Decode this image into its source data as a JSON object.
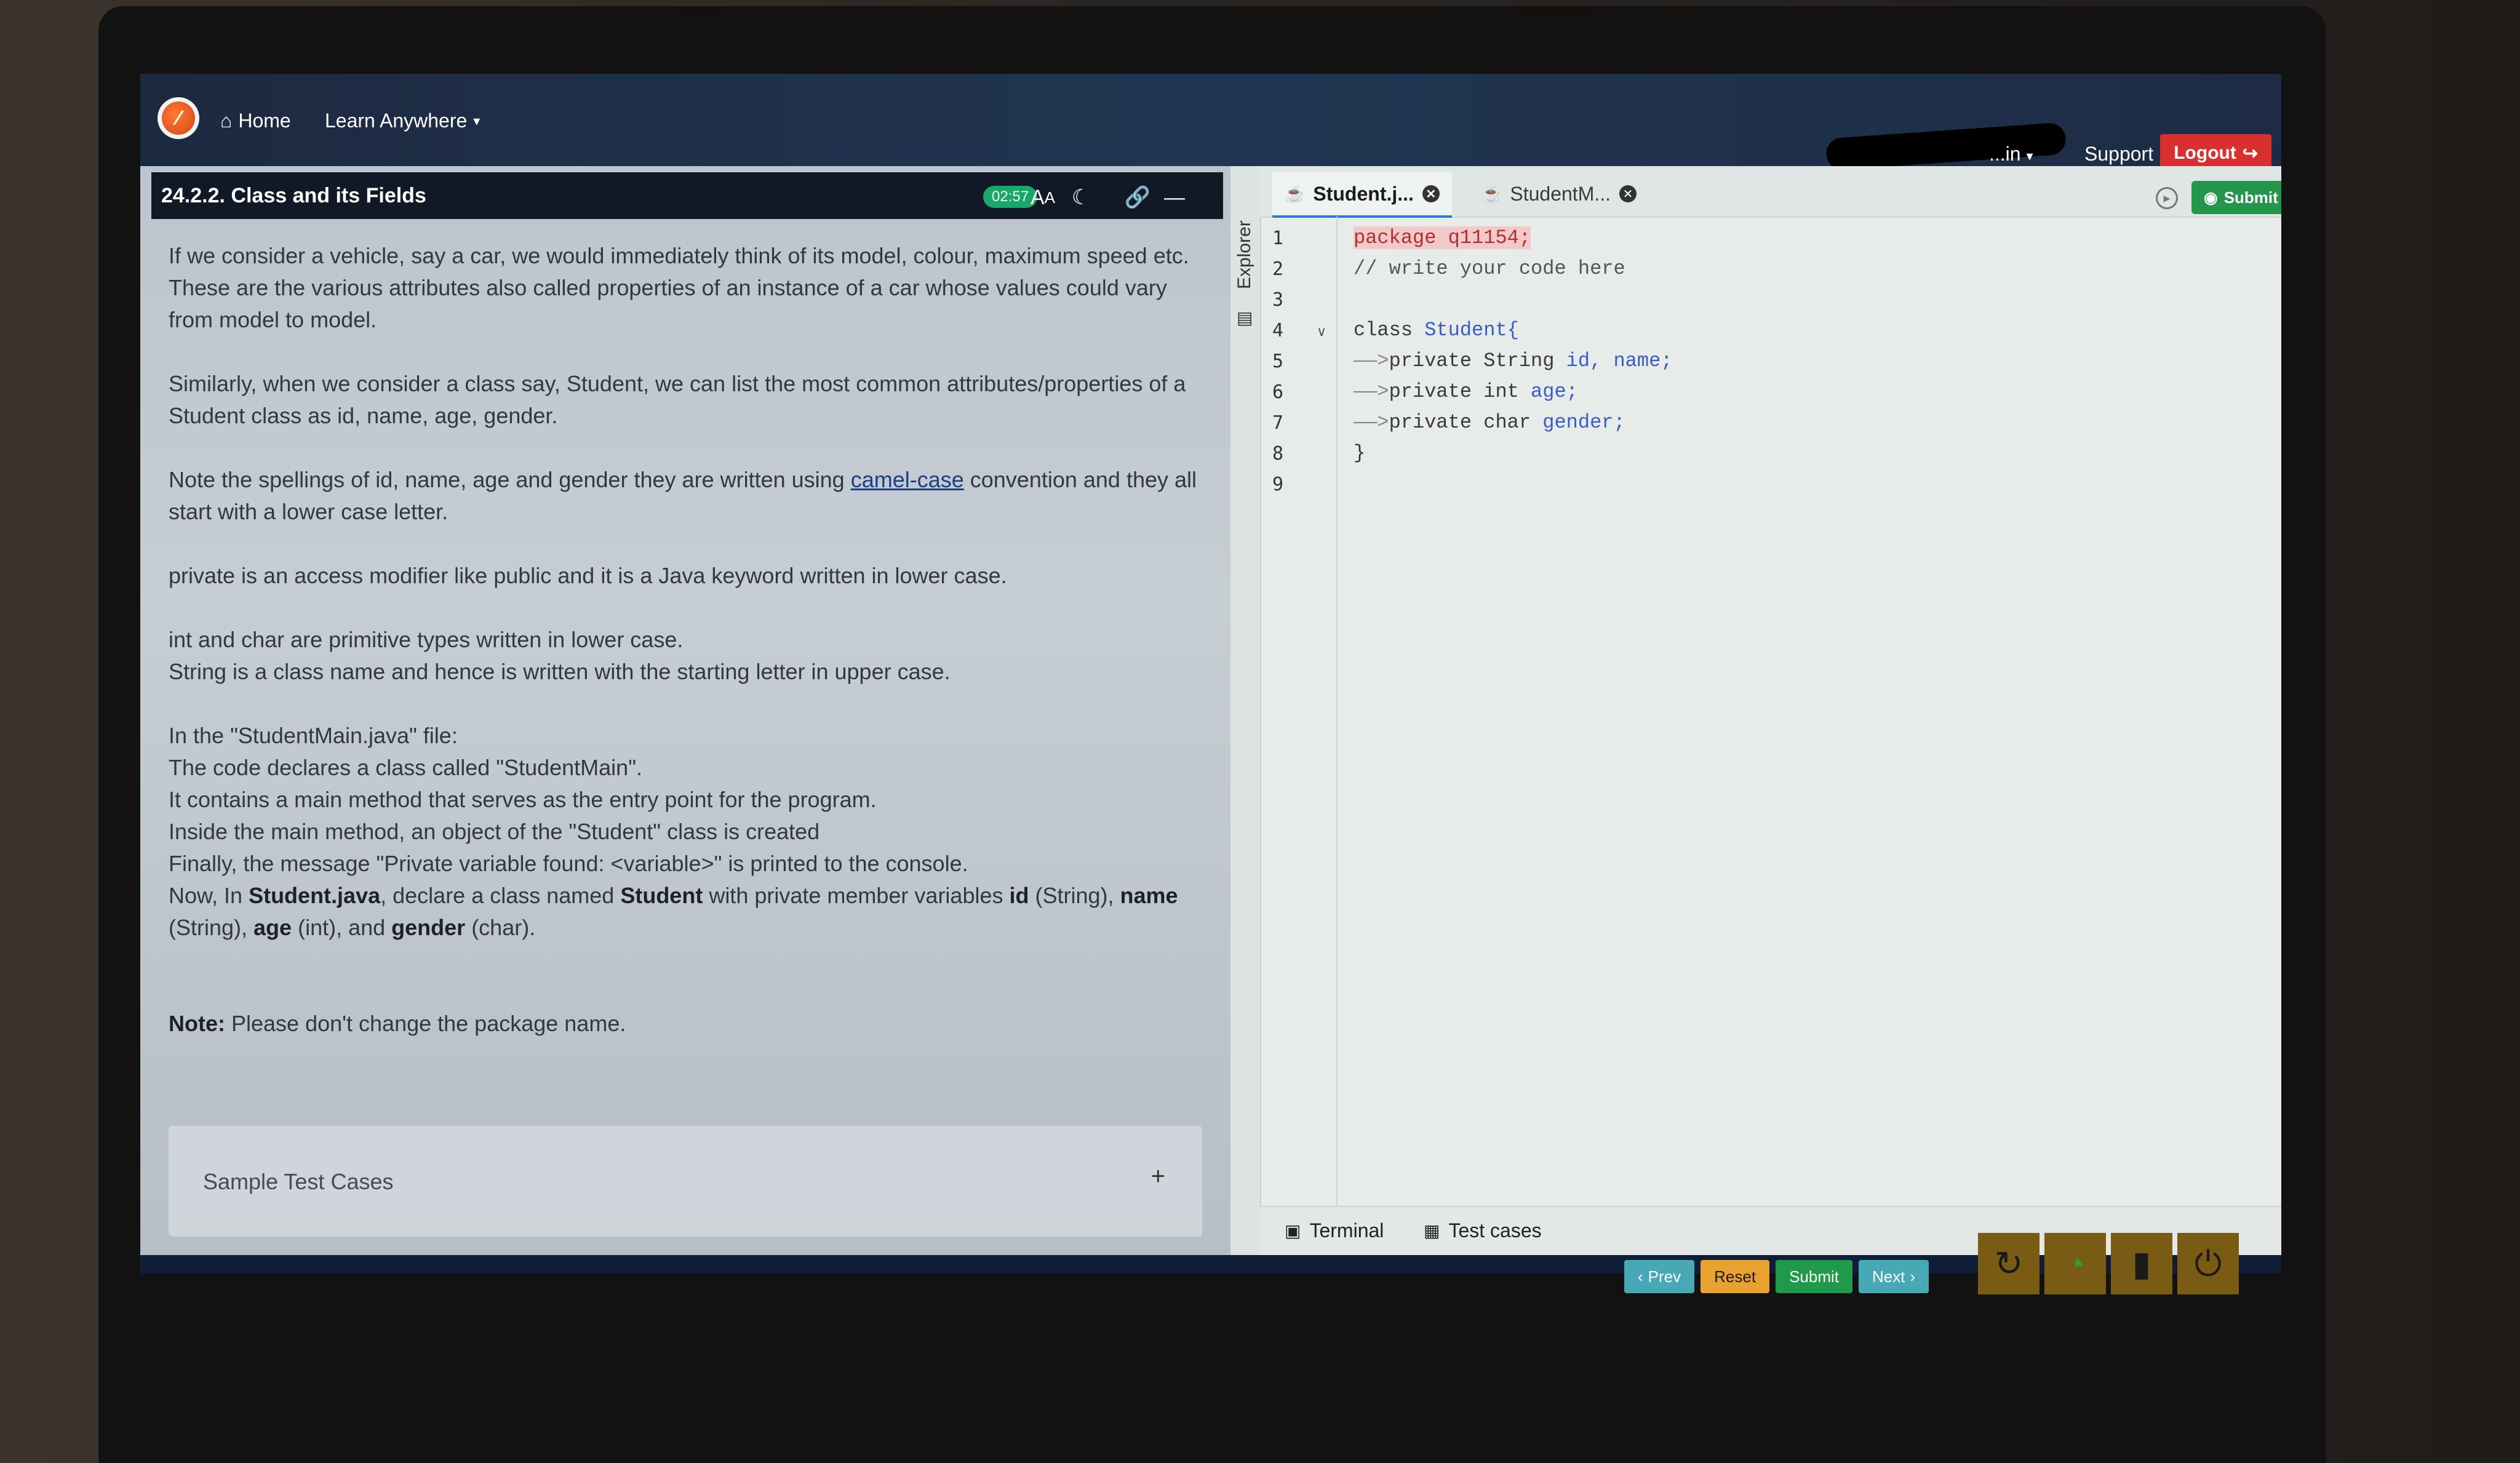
{
  "navbar": {
    "home_label": "Home",
    "learn_label": "Learn Anywhere",
    "user_label": "...in",
    "support_label": "Support",
    "logout_label": "Logout"
  },
  "lesson": {
    "title": "24.2.2. Class and its Fields",
    "timer": "02:57",
    "paragraphs": [
      "If we consider a vehicle, say a car, we would immediately think of its model, colour, maximum speed etc. These are the various attributes also called properties of an instance of a car whose values could vary from model to model.",
      "Similarly, when we consider a class say, Student, we can list the most common attributes/properties of a Student class as id, name, age, gender.",
      "private is an access modifier like public and it is a Java keyword written in lower case."
    ],
    "camel_pre": "Note the spellings of id, name, age and gender they are written using ",
    "camel_link": "camel-case",
    "camel_post": " convention and they all start with a lower case letter.",
    "primitives_1": "int and char are primitive types written in lower case.",
    "primitives_2": "String is a class name and hence is written with the starting letter in upper case.",
    "main_lines": [
      "In the \"StudentMain.java\" file:",
      "The code declares a class called \"StudentMain\".",
      "It contains a main method that serves as the entry point for the program.",
      "Inside the main method, an object of the \"Student\" class is created",
      "Finally, the message \"Private variable found: <variable>\" is printed to the console."
    ],
    "now": {
      "t1": "Now, In ",
      "b1": "Student.java",
      "t2": ", declare a class named ",
      "b2": "Student",
      "t3": " with private member variables ",
      "b3": "id",
      "t4": " (String), ",
      "b4": "name",
      "t5": " (String), ",
      "b5": "age",
      "t6": " (int), and ",
      "b6": "gender",
      "t7": " (char)."
    },
    "note_bold": "Note:",
    "note_text": " Please don't change the package name.",
    "sample_label": "Sample Test Cases",
    "sample_plus": "+"
  },
  "editor": {
    "explorer_label": "Explorer",
    "tabs": [
      {
        "label": "Student.j...",
        "active": true
      },
      {
        "label": "StudentM...",
        "active": false
      }
    ],
    "submit_label": "Submit",
    "line_numbers": [
      "1",
      "2",
      "3",
      "4",
      "5",
      "6",
      "7",
      "8",
      "9"
    ],
    "code": {
      "l1": "package q11154;",
      "l2": "// write your code here",
      "l4_kw": "class ",
      "l4_cls": "Student{",
      "l5_kw": "private String ",
      "l5_var": "id, name;",
      "l6_kw": "private int ",
      "l6_var": "age;",
      "l7_kw": "private char ",
      "l7_var": "gender;",
      "l8": "}"
    },
    "terminal_label": "Terminal",
    "testcases_label": "Test cases"
  },
  "footer": {
    "prev_label": "Prev",
    "reset_label": "Reset",
    "submit_label": "Submit",
    "next_label": "Next"
  },
  "icons": {
    "home": "home-icon",
    "timer": "timer-badge",
    "font_size": "font-size-icon",
    "dark_mode": "moon-icon",
    "link": "link-icon",
    "minimize": "minimize-icon",
    "java_file": "java-file-icon",
    "close_tab": "close-icon",
    "run": "run-icon",
    "terminal": "terminal-icon",
    "test_cases": "table-icon",
    "refresh": "refresh-icon",
    "wifi": "wifi-icon",
    "battery": "battery-icon",
    "power": "power-icon"
  },
  "colors": {
    "logout": "#d9302f",
    "submit": "#23964c",
    "timer": "#1aa86a",
    "prev_next": "#48a9b6",
    "reset": "#e7a22f"
  }
}
